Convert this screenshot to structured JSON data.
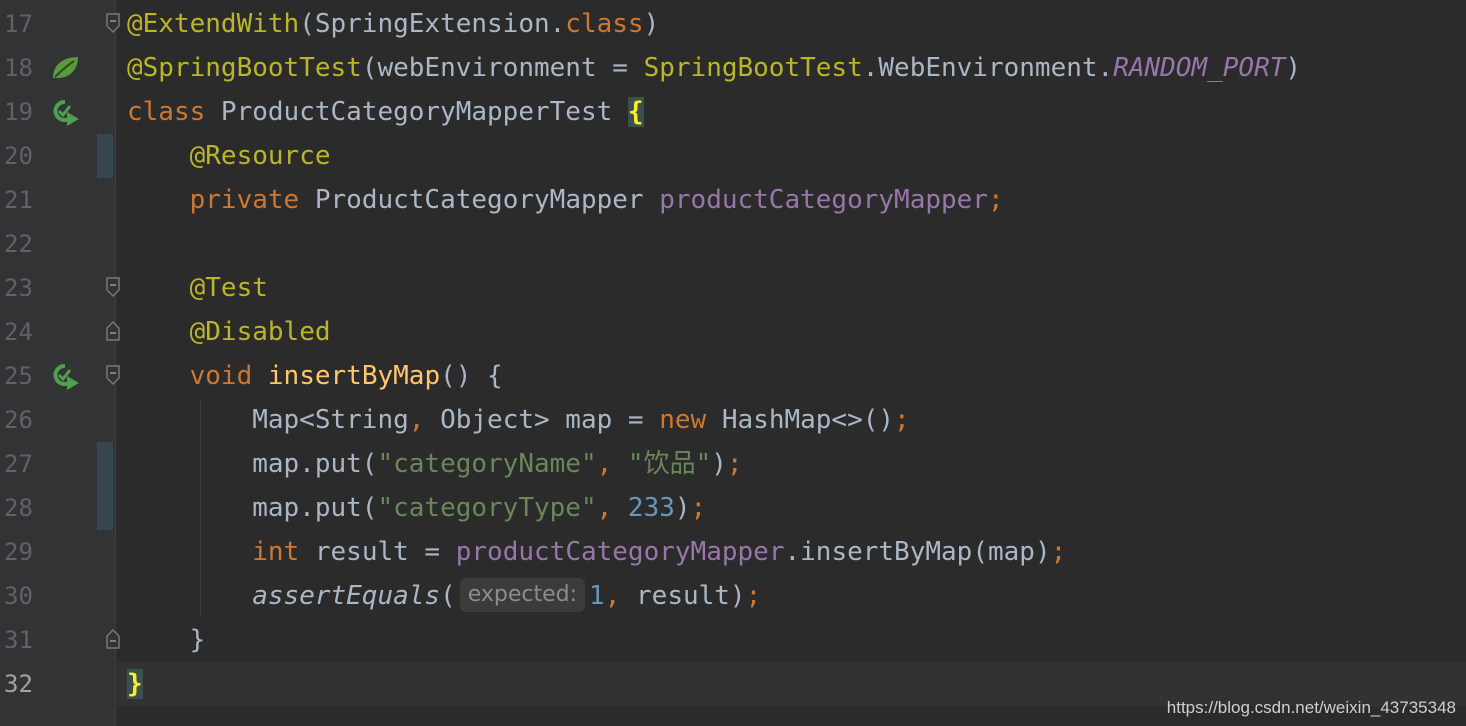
{
  "colors": {
    "background": "#2b2b2b",
    "annotation": "#bbb529",
    "keyword": "#cc7832",
    "field": "#9876aa",
    "string": "#6a8759",
    "number": "#6897bb",
    "plain": "#a9b7c6",
    "function": "#ffc66d",
    "brace_match": "#ffef28"
  },
  "gutter_icons": {
    "18": "spring-bean-leaf-icon",
    "19": "run-test-icon",
    "25": "run-test-icon"
  },
  "lines": [
    {
      "num": "17",
      "tokens": [
        {
          "t": "@ExtendWith",
          "c": "annotation"
        },
        {
          "t": "(SpringExtension.",
          "c": "plain"
        },
        {
          "t": "class",
          "c": "keyword"
        },
        {
          "t": ")",
          "c": "plain"
        }
      ]
    },
    {
      "num": "18",
      "tokens": [
        {
          "t": "@SpringBootTest",
          "c": "annotation"
        },
        {
          "t": "(webEnvironment = ",
          "c": "plain"
        },
        {
          "t": "SpringBootTest",
          "c": "annotation"
        },
        {
          "t": ".WebEnvironment.",
          "c": "plain"
        },
        {
          "t": "RANDOM_PORT",
          "c": "field-italic"
        },
        {
          "t": ")",
          "c": "plain"
        }
      ]
    },
    {
      "num": "19",
      "tokens": [
        {
          "t": "class ",
          "c": "keyword"
        },
        {
          "t": "ProductCategoryMapperTest ",
          "c": "plain"
        },
        {
          "t": "{",
          "c": "brace"
        }
      ]
    },
    {
      "num": "20",
      "tokens": [
        {
          "t": "    ",
          "c": "plain"
        },
        {
          "t": "@Resource",
          "c": "annotation"
        }
      ]
    },
    {
      "num": "21",
      "tokens": [
        {
          "t": "    ",
          "c": "plain"
        },
        {
          "t": "private ",
          "c": "keyword"
        },
        {
          "t": "ProductCategoryMapper ",
          "c": "plain"
        },
        {
          "t": "productCategoryMapper",
          "c": "field"
        },
        {
          "t": ";",
          "c": "keyword"
        }
      ]
    },
    {
      "num": "22",
      "tokens": []
    },
    {
      "num": "23",
      "tokens": [
        {
          "t": "    ",
          "c": "plain"
        },
        {
          "t": "@Test",
          "c": "annotation"
        }
      ]
    },
    {
      "num": "24",
      "tokens": [
        {
          "t": "    ",
          "c": "plain"
        },
        {
          "t": "@Disabled",
          "c": "annotation"
        }
      ]
    },
    {
      "num": "25",
      "tokens": [
        {
          "t": "    ",
          "c": "plain"
        },
        {
          "t": "void ",
          "c": "keyword"
        },
        {
          "t": "insertByMap",
          "c": "function"
        },
        {
          "t": "() {",
          "c": "plain"
        }
      ]
    },
    {
      "num": "26",
      "tokens": [
        {
          "t": "        Map<String",
          "c": "plain"
        },
        {
          "t": ", ",
          "c": "keyword"
        },
        {
          "t": "Object> map = ",
          "c": "plain"
        },
        {
          "t": "new ",
          "c": "keyword"
        },
        {
          "t": "HashMap<>()",
          "c": "plain"
        },
        {
          "t": ";",
          "c": "keyword"
        }
      ]
    },
    {
      "num": "27",
      "tokens": [
        {
          "t": "        map.put(",
          "c": "plain"
        },
        {
          "t": "\"categoryName\"",
          "c": "string"
        },
        {
          "t": ", ",
          "c": "keyword"
        },
        {
          "t": "\"饮品\"",
          "c": "string"
        },
        {
          "t": ")",
          "c": "plain"
        },
        {
          "t": ";",
          "c": "keyword"
        }
      ]
    },
    {
      "num": "28",
      "tokens": [
        {
          "t": "        map.put(",
          "c": "plain"
        },
        {
          "t": "\"categoryType\"",
          "c": "string"
        },
        {
          "t": ", ",
          "c": "keyword"
        },
        {
          "t": "233",
          "c": "number"
        },
        {
          "t": ")",
          "c": "plain"
        },
        {
          "t": ";",
          "c": "keyword"
        }
      ]
    },
    {
      "num": "29",
      "tokens": [
        {
          "t": "        ",
          "c": "plain"
        },
        {
          "t": "int ",
          "c": "keyword"
        },
        {
          "t": "result = ",
          "c": "plain"
        },
        {
          "t": "productCategoryMapper",
          "c": "field"
        },
        {
          "t": ".insertByMap(map)",
          "c": "plain"
        },
        {
          "t": ";",
          "c": "keyword"
        }
      ]
    },
    {
      "num": "30",
      "tokens": [
        {
          "t": "        ",
          "c": "plain"
        },
        {
          "t": "assertEquals",
          "c": "italic"
        },
        {
          "t": "(",
          "c": "plain"
        },
        {
          "t": "expected:",
          "c": "hint"
        },
        {
          "t": "1",
          "c": "number"
        },
        {
          "t": ", ",
          "c": "keyword"
        },
        {
          "t": "result)",
          "c": "plain"
        },
        {
          "t": ";",
          "c": "keyword"
        }
      ]
    },
    {
      "num": "31",
      "tokens": [
        {
          "t": "    }",
          "c": "plain"
        }
      ]
    },
    {
      "num": "32",
      "tokens": [
        {
          "t": "}",
          "c": "brace"
        }
      ]
    }
  ],
  "watermark": "https://blog.csdn.net/weixin_43735348"
}
